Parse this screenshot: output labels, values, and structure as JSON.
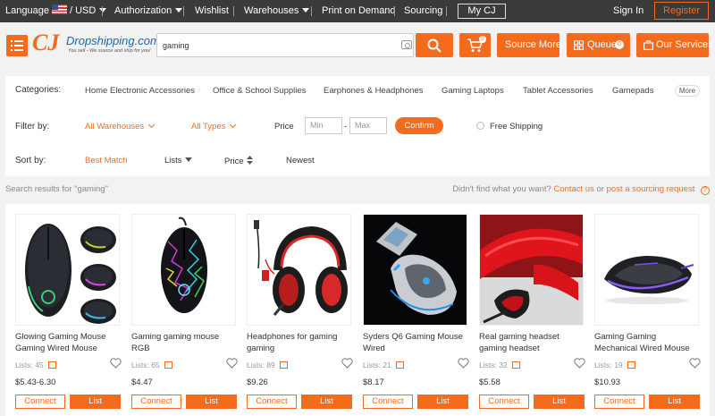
{
  "topbar": {
    "language": "Language",
    "currency": "/ USD",
    "authorization": "Authorization",
    "wishlist": "Wishlist",
    "warehouses": "Warehouses",
    "print_on_demand": "Print on Demand",
    "sourcing": "Sourcing",
    "my_cj": "My CJ",
    "sign_in": "Sign In",
    "register": "Register"
  },
  "header": {
    "logo_mark": "CJ",
    "logo_name": "Dropshipping.com",
    "logo_tagline": "You sell - We source and ship for you!",
    "search_value": "gaming",
    "cart_count": "0",
    "source_more": "Source More",
    "queue": "Queue",
    "queue_count": "0",
    "our_services": "Our Services",
    "brand_color": "#f56b1d"
  },
  "filters": {
    "categories_label": "Categories:",
    "categories": [
      "Home Electronic Accessories",
      "Office & School Supplies",
      "Earphones & Headphones",
      "Gaming Laptops",
      "Tablet Accessories",
      "Gamepads"
    ],
    "more": "More",
    "filter_label": "Filter by:",
    "warehouses": "All Warehouses",
    "types": "All Types",
    "price_label": "Price",
    "min_placeholder": "Min",
    "dash": "-",
    "max_placeholder": "Max",
    "confirm": "Confirm",
    "free_shipping": "Free Shipping",
    "sort_label": "Sort by:",
    "sort_options": [
      "Best Match",
      "Lists",
      "Price",
      "Newest"
    ]
  },
  "results": {
    "summary": "Search results for \"gaming\"",
    "not_found": "Didn't find what you want?",
    "contact_us": "Contact us",
    "or": "or",
    "post_request": "post a sourcing request",
    "help_icon": "?"
  },
  "products": [
    {
      "title": "Glowing Gaming Mouse Gaming Wired Mouse",
      "lists": "Lists: 45",
      "price": "$5.43-6.30",
      "connect": "Connect",
      "list": "List"
    },
    {
      "title": "Gaming gaming mouse RGB",
      "lists": "Lists: 65",
      "price": "$4.47",
      "connect": "Connect",
      "list": "List"
    },
    {
      "title": "Headphones for gaming gaming",
      "lists": "Lists: 89",
      "price": "$9.26",
      "connect": "Connect",
      "list": "List"
    },
    {
      "title": "Syders Q6 Gaming Mouse Wired",
      "lists": "Lists: 21",
      "price": "$8.17",
      "connect": "Connect",
      "list": "List"
    },
    {
      "title": "Real gaming headset gaming headset",
      "lists": "Lists: 32",
      "price": "$5.58",
      "connect": "Connect",
      "list": "List"
    },
    {
      "title": "Gaming Gaming Mechanical Wired Mouse",
      "lists": "Lists: 19",
      "price": "$10.93",
      "connect": "Connect",
      "list": "List"
    }
  ]
}
